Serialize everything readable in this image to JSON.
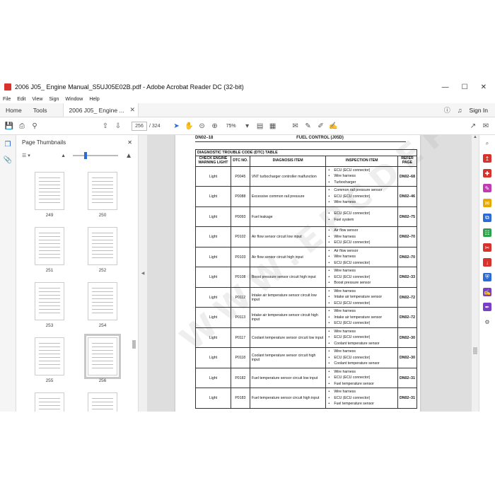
{
  "window": {
    "title": "2006 J05_ Engine Manual_S5UJ05E02B.pdf - Adobe Acrobat Reader DC (32-bit)"
  },
  "menu": [
    "File",
    "Edit",
    "View",
    "Sign",
    "Window",
    "Help"
  ],
  "tabs": {
    "home": "Home",
    "tools": "Tools",
    "document": "2006 J05_ Engine ..."
  },
  "account": {
    "signin": "Sign In"
  },
  "toolbar": {
    "current_page": "256",
    "total_pages": "/ 324",
    "zoom": "75%"
  },
  "thumbnails": {
    "title": "Page Thumbnails",
    "pages": [
      {
        "label": "249"
      },
      {
        "label": "250"
      },
      {
        "label": "251"
      },
      {
        "label": "252"
      },
      {
        "label": "253"
      },
      {
        "label": "254"
      },
      {
        "label": "255"
      },
      {
        "label": "256"
      }
    ],
    "selected": "256"
  },
  "document": {
    "header_left": "DN02–18",
    "header_center": "FUEL CONTROL (J05D)",
    "table_caption": "DIAGNOSTIC TROUBLE CODE (DTC) TABLE",
    "columns": [
      "CHECK ENGINE WARNING LIGHT",
      "DTC NO.",
      "DIAGNOSIS ITEM",
      "INSPECTION ITEM",
      "REFER PAGE"
    ],
    "rows": [
      {
        "light": "Light",
        "dtc": "P0045",
        "diag": "VNT turbocharger controller malfunction",
        "insp": [
          "ECU (ECU connector)",
          "Wire harness",
          "Turbocharger"
        ],
        "ref": "DN02–68"
      },
      {
        "light": "Light",
        "dtc": "P0088",
        "diag": "Excessive common rail pressure",
        "insp": [
          "Common rail pressure sensor",
          "ECU (ECU connector)",
          "Wire harness"
        ],
        "ref": "DN02–46"
      },
      {
        "light": "Light",
        "dtc": "P0093",
        "diag": "Fuel leakage",
        "insp": [
          "ECU (ECU connector)",
          "Fuel system"
        ],
        "ref": "DN02–75"
      },
      {
        "light": "Light",
        "dtc": "P0102",
        "diag": "Air flow sensor circuit low input",
        "insp": [
          "Air flow sensor",
          "Wire harness",
          "ECU (ECU connector)"
        ],
        "ref": "DN02–70"
      },
      {
        "light": "Light",
        "dtc": "P0103",
        "diag": "Air flow sensor circuit high input",
        "insp": [
          "Air flow sensor",
          "Wire harness",
          "ECU (ECU connector)"
        ],
        "ref": "DN02–70"
      },
      {
        "light": "Light",
        "dtc": "P0108",
        "diag": "Boost pressure sensor circuit high input",
        "insp": [
          "Wire harness",
          "ECU (ECU connector)",
          "Boost pressure sensor"
        ],
        "ref": "DN02–33"
      },
      {
        "light": "Light",
        "dtc": "P0112",
        "diag": "Intake air temperature sensor circuit low input",
        "insp": [
          "Wire harness",
          "Intake air temperature sensor",
          "ECU (ECU connector)"
        ],
        "ref": "DN02–72"
      },
      {
        "light": "Light",
        "dtc": "P0113",
        "diag": "Intake air temperature sensor circuit high input",
        "insp": [
          "Wire harness",
          "Intake air temperature sensor",
          "ECU (ECU connector)"
        ],
        "ref": "DN02–72"
      },
      {
        "light": "Light",
        "dtc": "P0117",
        "diag": "Coolant temperature sensor circuit low input",
        "insp": [
          "Wire harness",
          "ECU (ECU connector)",
          "Coolant temperature sensor"
        ],
        "ref": "DN02–30"
      },
      {
        "light": "Light",
        "dtc": "P0118",
        "diag": "Coolant temperature sensor circuit high input",
        "insp": [
          "Wire harness",
          "ECU (ECU connector)",
          "Coolant temperature sensor"
        ],
        "ref": "DN02–30"
      },
      {
        "light": "Light",
        "dtc": "P0182",
        "diag": "Fuel temperature sensor circuit low input",
        "insp": [
          "Wire harness",
          "ECU (ECU connector)",
          "Fuel temperature sensor"
        ],
        "ref": "DN02–31"
      },
      {
        "light": "Light",
        "dtc": "P0183",
        "diag": "Fuel temperature sensor circuit high input",
        "insp": [
          "Wire harness",
          "ECU (ECU connector)",
          "Fuel temperature sensor"
        ],
        "ref": "DN02–31"
      }
    ]
  },
  "watermark": "WWW.EPCDEPOT.COM",
  "colors": {
    "accent": "#2a6bd6",
    "pdf_red": "#d8322c",
    "canvas": "#dedede"
  },
  "icons": {
    "toolbar": [
      "save-icon",
      "print-icon",
      "search-icon",
      "page-up-icon",
      "page-down-icon",
      "select-cursor-icon",
      "hand-icon",
      "zoom-out-icon",
      "zoom-in-icon",
      "fit-page-icon",
      "scroll-mode-icon",
      "comment-icon",
      "highlight-icon",
      "draw-icon",
      "fill-sign-icon"
    ],
    "right_rail": [
      "search-icon",
      "export-pdf-icon",
      "create-pdf-icon",
      "edit-pdf-icon",
      "comment-icon",
      "combine-files-icon",
      "organize-pages-icon",
      "redact-icon",
      "compress-icon",
      "protect-icon",
      "fill-sign-icon",
      "send-sign-icon",
      "more-tools-icon"
    ]
  }
}
